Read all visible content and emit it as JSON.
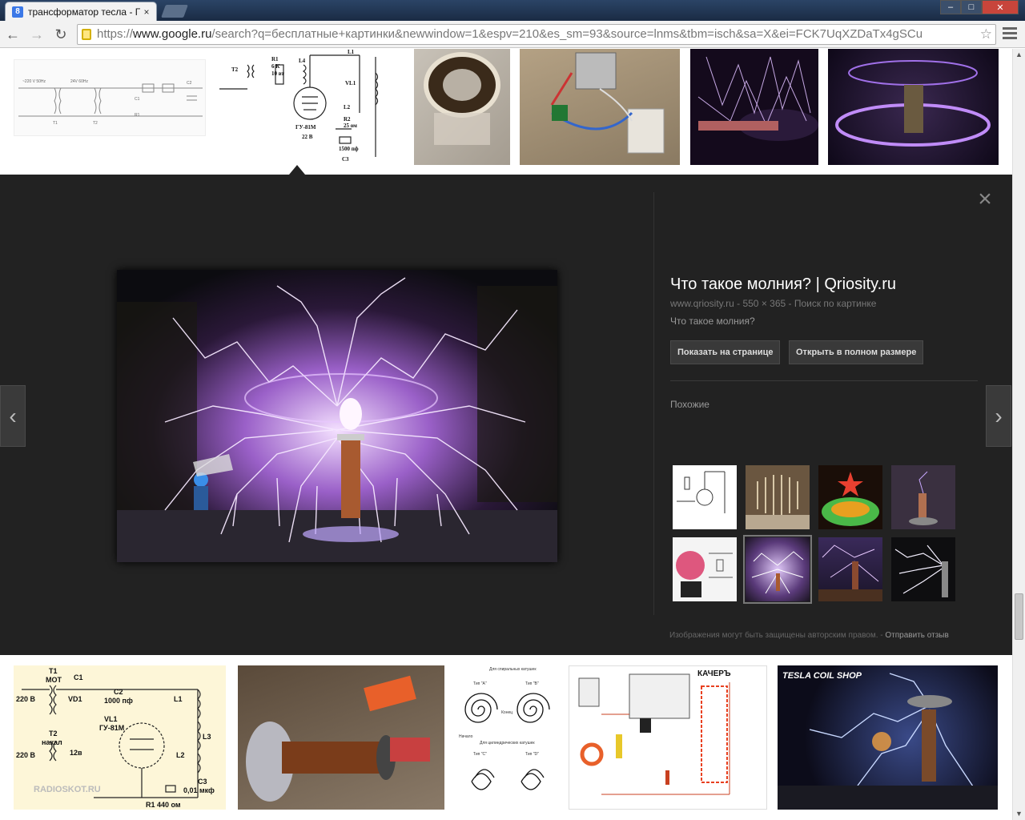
{
  "browser": {
    "tab_title": "трансформатор тесла - Г",
    "favicon_letter": "8",
    "tab_close": "×",
    "url_prefix": "https://",
    "url_domain": "www.google.ru",
    "url_rest": "/search?q=бесплатные+картинки&newwindow=1&espv=210&es_sm=93&source=lnms&tbm=isch&sa=X&ei=FCK7UqXZDaTx4gSCu",
    "window_controls": [
      "–",
      "□",
      "✕"
    ]
  },
  "preview": {
    "title": "Что такое молния? | Qriosity.ru",
    "meta": "www.qriosity.ru - 550 × 365 - Поиск по картинке",
    "description": "Что такое молния?",
    "btn_show": "Показать на странице",
    "btn_open": "Открыть в полном размере",
    "similar_label": "Похожие",
    "copyright": "Изображения могут быть защищены авторским правом.",
    "separator": "-",
    "feedback": "Отправить отзыв",
    "close_icon": "×",
    "prev_icon": "‹",
    "next_icon": "›"
  },
  "schematic_top": {
    "labels": [
      "R1",
      "L4",
      "L1",
      "VL1",
      "L2",
      "R2",
      "C3",
      "T2",
      "22 В",
      "1500 пф",
      "ГУ-81М",
      "6 К",
      "10 вт",
      "25 ом"
    ]
  },
  "schematic_bottom": {
    "labels": [
      "T1",
      "MOT",
      "C1",
      "220 В",
      "VD1",
      "C2",
      "1000 пф",
      "L1",
      "VL1",
      "ГУ-81М",
      "T2",
      "накал",
      "12в",
      "220 В",
      "L3",
      "L2",
      "C3",
      "0,01 мкф",
      "R1 440 ом"
    ],
    "watermark": "RADIOSKOT.RU"
  },
  "coils": {
    "labels": [
      "Для спиральных катушек",
      "Тип \"А\"",
      "Тип \"В\"",
      "Конец",
      "Начало",
      "Для цилиндрических катушек",
      "Тип \"С\"",
      "Тип \"D\""
    ]
  },
  "kacher": {
    "title": "КАЧЕРЪ"
  },
  "shop": {
    "title": "TESLA COIL SHOP"
  }
}
